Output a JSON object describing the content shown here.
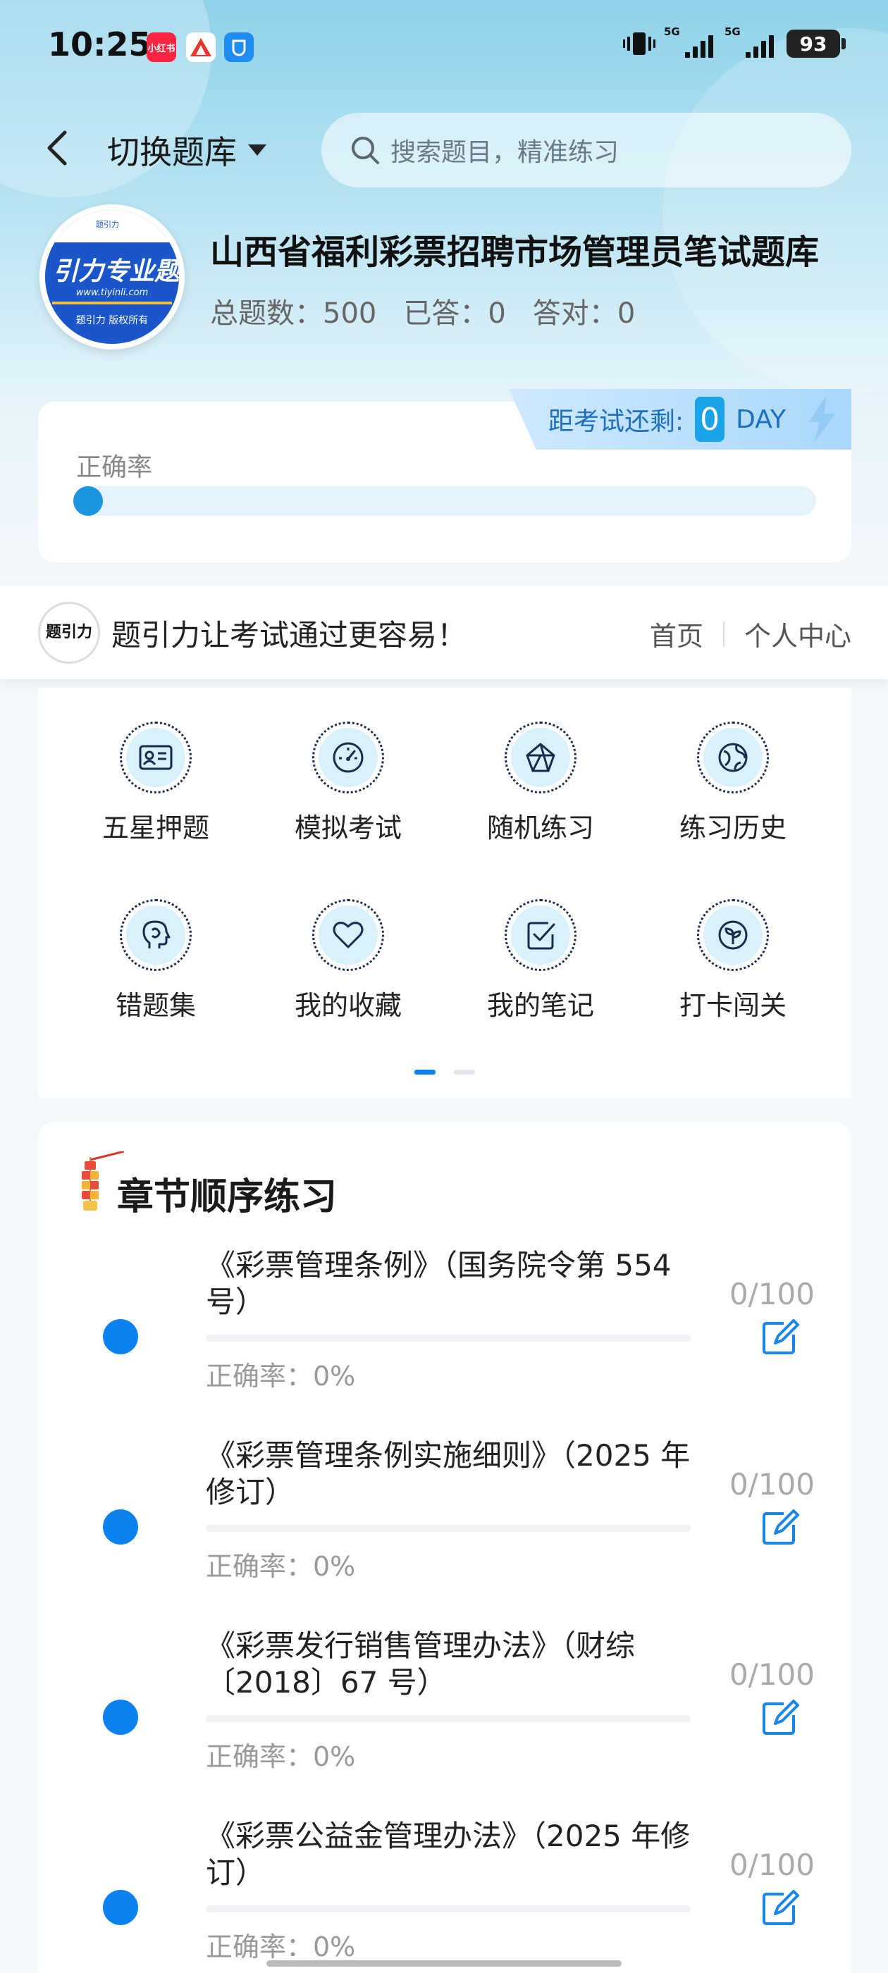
{
  "status_bar": {
    "time": "10:25",
    "apps": [
      {
        "name": "xiaohongshu-icon",
        "label": "小红书",
        "color": "#ff2442"
      },
      {
        "name": "kaoyan-app-icon",
        "label": "",
        "color": "#ffffff"
      },
      {
        "name": "shield-app-icon",
        "label": "",
        "color": "#1e8cf0"
      }
    ],
    "signal_1": "5G",
    "signal_2": "5G",
    "battery": "93"
  },
  "header": {
    "switch_label": "切换题库",
    "search_placeholder": "搜索题目，精准练习"
  },
  "bank": {
    "logo": {
      "top": "题引力",
      "main": "引力专业题",
      "url": "www.tiyinli.com",
      "copyright": "题引力 版权所有"
    },
    "title": "山西省福利彩票招聘市场管理员笔试题库",
    "stats": {
      "total_label": "总题数：",
      "total": "500",
      "answered_label": "已答：",
      "answered": "0",
      "correct_label": "答对：",
      "correct": "0"
    }
  },
  "countdown": {
    "label": "距考试还剩:",
    "value": "0",
    "unit": "DAY"
  },
  "accuracy": {
    "label": "正确率",
    "value": 0
  },
  "brand": {
    "logo_text": "题引力",
    "slogan": "题引力让考试通过更容易！",
    "nav": [
      "首页",
      "个人中心"
    ]
  },
  "grid": {
    "items": [
      {
        "label": "五星押题",
        "icon": "id-card-icon"
      },
      {
        "label": "模拟考试",
        "icon": "gauge-icon"
      },
      {
        "label": "随机练习",
        "icon": "network-icon"
      },
      {
        "label": "练习历史",
        "icon": "globe-icon"
      },
      {
        "label": "错题集",
        "icon": "head-icon"
      },
      {
        "label": "我的收藏",
        "icon": "heart-icon"
      },
      {
        "label": "我的笔记",
        "icon": "checklist-icon"
      },
      {
        "label": "打卡闯关",
        "icon": "sprout-icon"
      }
    ],
    "pages": 2,
    "active_page": 0
  },
  "chapters": {
    "heading": "章节顺序练习",
    "items": [
      {
        "title": "《彩票管理条例》（国务院令第 554 号）",
        "accuracy": "正确率：0%",
        "progress": "0/100"
      },
      {
        "title": "《彩票管理条例实施细则》（2025 年修订）",
        "accuracy": "正确率：0%",
        "progress": "0/100"
      },
      {
        "title": "《彩票发行销售管理办法》（财综〔2018〕67 号）",
        "accuracy": "正确率：0%",
        "progress": "0/100"
      },
      {
        "title": "《彩票公益金管理办法》（2025 年修订）",
        "accuracy": "正确率：0%",
        "progress": "0/100"
      }
    ]
  },
  "colors": {
    "accent": "#0b82f0",
    "countdown": "#1aa3e8",
    "icon_bg": "#d8f1fa"
  }
}
